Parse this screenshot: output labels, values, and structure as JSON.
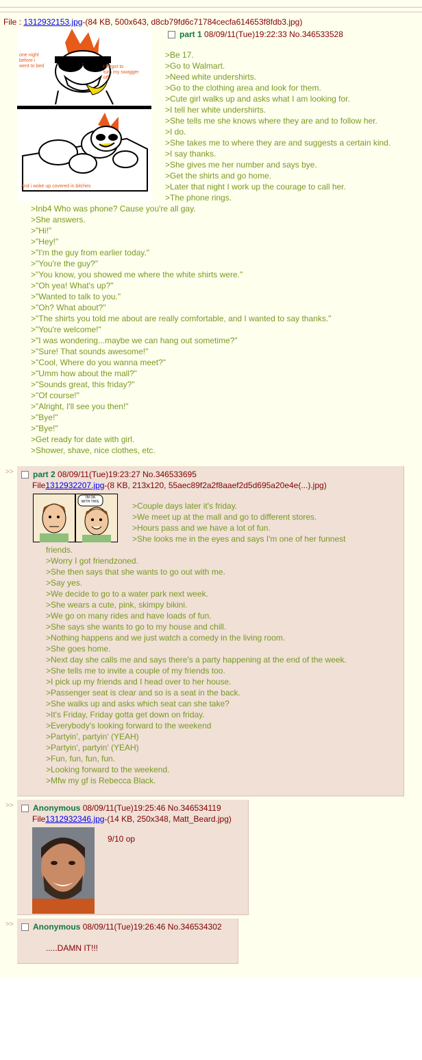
{
  "op": {
    "file_prefix": "File : ",
    "file_name": "1312932153.jpg",
    "file_meta": "-(84 KB, 500x643, d8cb79fd6c71784cecfa614653f8fdb3.jpg)",
    "title": "part 1",
    "datetime": "08/09/11(Tue)19:22:33",
    "number": "No.346533528",
    "image_captions": {
      "top_left": "one night\nbefore i\nwent to bed",
      "top_right": "i forgot to\nturn my swagger\noff",
      "bottom": "and i woke up covered in bitches"
    },
    "lines_side": [
      ">Be 17.",
      ">Go to Walmart.",
      ">Need white undershirts.",
      ">Go to the clothing area and look for them.",
      ">Cute girl walks up and asks what I am looking for.",
      ">I tell her white undershirts.",
      ">She tells me she knows where they are and to follow her.",
      ">I do.",
      ">She takes me to where they are and suggests a certain kind.",
      ">I say thanks.",
      ">She gives me her number and says bye.",
      ">Get the shirts and go home.",
      ">Later that night I work up the courage to call her.",
      ">The phone rings."
    ],
    "lines_full": [
      ">Inb4 Who was phone? Cause you're all gay.",
      ">She answers.",
      ">\"Hi!\"",
      ">\"Hey!\"",
      ">\"I'm the guy from earlier today.\"",
      ">\"You're the guy?\"",
      ">\"You know, you showed me where the white shirts were.\"",
      ">\"Oh yea! What's up?\"",
      ">\"Wanted to talk to you.\"",
      ">\"Oh? What about?\"",
      ">\"The shirts you told me about are really comfortable, and I wanted to say thanks.\"",
      ">\"You're welcome!\"",
      ">\"I was wondering...maybe we can hang out sometime?\"",
      ">\"Sure! That sounds awesome!\"",
      ">\"Cool, Where do you wanna meet?\"",
      ">\"Umm how about the mall?\"",
      ">\"Sounds great, this friday?\"",
      ">\"Of course!\"",
      ">\"Alright, I'll see you then!\"",
      ">\"Bye!\"",
      ">\"Bye!\"",
      ">Get ready for date with girl.",
      ">Shower, shave, nice clothes, etc."
    ]
  },
  "replies": [
    {
      "arrows": ">>",
      "title": "part 2",
      "datetime": "08/09/11(Tue)19:23:27",
      "number": "No.346533695",
      "file_prefix": "File",
      "file_name": "1312932207.jpg",
      "file_meta": "-(8 KB, 213x120, 55aec89f2a2f8aaef2d5d695a20e4e(...).jpg)",
      "comic_text": "I'M OK\nWITH THIS.",
      "lines_side": [
        ">Couple days later it's friday.",
        ">We meet up at the mall and go to different stores.",
        ">Hours pass and we have a lot of fun.",
        ">She looks me in the eyes and says I'm one of her funnest"
      ],
      "lines_full": [
        "friends.",
        ">Worry I got friendzoned.",
        ">She then says that she wants to go out with me.",
        ">Say yes.",
        ">We decide to go to a water park next week.",
        ">She wears a cute, pink, skimpy bikini.",
        ">We go on many rides and have loads of fun.",
        ">She says she wants to go to my house and chill.",
        ">Nothing happens and we just watch a comedy in the living room.",
        ">She goes home.",
        ">Next day she calls me and says there's a party happening at the end of the week.",
        ">She tells me to invite a couple of my friends too.",
        ">I pick up my friends and I head over to her house.",
        ">Passenger seat is clear and so is a seat in the back.",
        ">She walks up and asks which seat can she take?",
        ">It's Friday, Friday gotta get down on friday.",
        ">Everybody's looking forward to the weekend",
        ">Partyin', partyin' (YEAH)",
        ">Partyin', partyin' (YEAH)",
        ">Fun, fun, fun, fun.",
        ">Looking forward to the weekend.",
        ">Mfw my gf is Rebecca Black."
      ]
    },
    {
      "arrows": ">>",
      "title": "Anonymous",
      "datetime": "08/09/11(Tue)19:25:46",
      "number": "No.346534119",
      "file_prefix": "File",
      "file_name": "1312932346.jpg",
      "file_meta": "-(14 KB, 250x348, Matt_Beard.jpg)",
      "comment": "9/10 op"
    },
    {
      "arrows": ">>",
      "title": "Anonymous",
      "datetime": "08/09/11(Tue)19:26:46",
      "number": "No.346534302",
      "comment": ".....DAMN IT!!!"
    }
  ],
  "colors": {
    "background": "#ffffee",
    "reply_background": "#f0e0d6",
    "name_green": "#117743",
    "greentext": "#789922",
    "text_maroon": "#800000",
    "link_blue": "#0000ee"
  }
}
